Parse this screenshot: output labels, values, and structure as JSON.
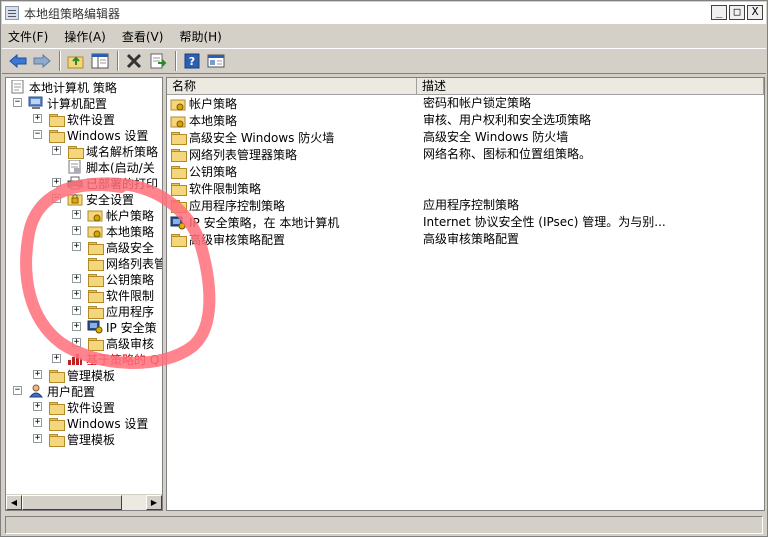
{
  "window": {
    "title": "本地组策略编辑器",
    "controls": [
      "_",
      "□",
      "X"
    ]
  },
  "menubar": [
    "文件(F)",
    "操作(A)",
    "查看(V)",
    "帮助(H)"
  ],
  "toolbar": {
    "icons": [
      "back-arrow-icon",
      "forward-arrow-icon",
      "up-folder-icon",
      "show-hide-tree-icon",
      "delete-icon",
      "export-list-icon",
      "help-icon",
      "properties-icon"
    ]
  },
  "tree": {
    "root": "本地计算机 策略",
    "computer_config": "计算机配置",
    "software_settings": "软件设置",
    "windows_settings": "Windows 设置",
    "dns_policy": "域名解析策略",
    "scripts": "脚本(启动/关",
    "deployed_printers": "已部署的打印",
    "security_settings": "安全设置",
    "account_policies": "帐户策略",
    "local_policies": "本地策略",
    "advanced_firewall": "高级安全",
    "network_list": "网络列表管",
    "public_key": "公钥策略",
    "software_restriction": "软件限制",
    "app_control": "应用程序",
    "ip_security": "IP 安全策",
    "advanced_audit": "高级审核",
    "qos": "基于策略的 Q",
    "admin_templates": "管理模板",
    "user_config": "用户配置",
    "user_software": "软件设置",
    "user_windows": "Windows 设置",
    "user_admin_templates": "管理模板"
  },
  "list": {
    "col_name": "名称",
    "col_desc": "描述",
    "rows": [
      {
        "name": "帐户策略",
        "desc": "密码和帐户锁定策略",
        "icon": "folder-lock-icon"
      },
      {
        "name": "本地策略",
        "desc": "审核、用户权利和安全选项策略",
        "icon": "folder-lock-icon"
      },
      {
        "name": "高级安全 Windows 防火墙",
        "desc": "高级安全 Windows 防火墙",
        "icon": "folder-icon"
      },
      {
        "name": "网络列表管理器策略",
        "desc": "网络名称、图标和位置组策略。",
        "icon": "folder-icon"
      },
      {
        "name": "公钥策略",
        "desc": "",
        "icon": "folder-icon"
      },
      {
        "name": "软件限制策略",
        "desc": "",
        "icon": "folder-icon"
      },
      {
        "name": "应用程序控制策略",
        "desc": "应用程序控制策略",
        "icon": "folder-icon"
      },
      {
        "name": "IP 安全策略，在 本地计算机",
        "desc": "Internet 协议安全性 (IPsec) 管理。为与别...",
        "icon": "ip-security-icon"
      },
      {
        "name": "高级审核策略配置",
        "desc": "高级审核策略配置",
        "icon": "folder-icon"
      }
    ]
  },
  "colors": {
    "annotation": "#ff6f7a",
    "folder": "#f4d77d",
    "qos_text": "#cc0000"
  }
}
